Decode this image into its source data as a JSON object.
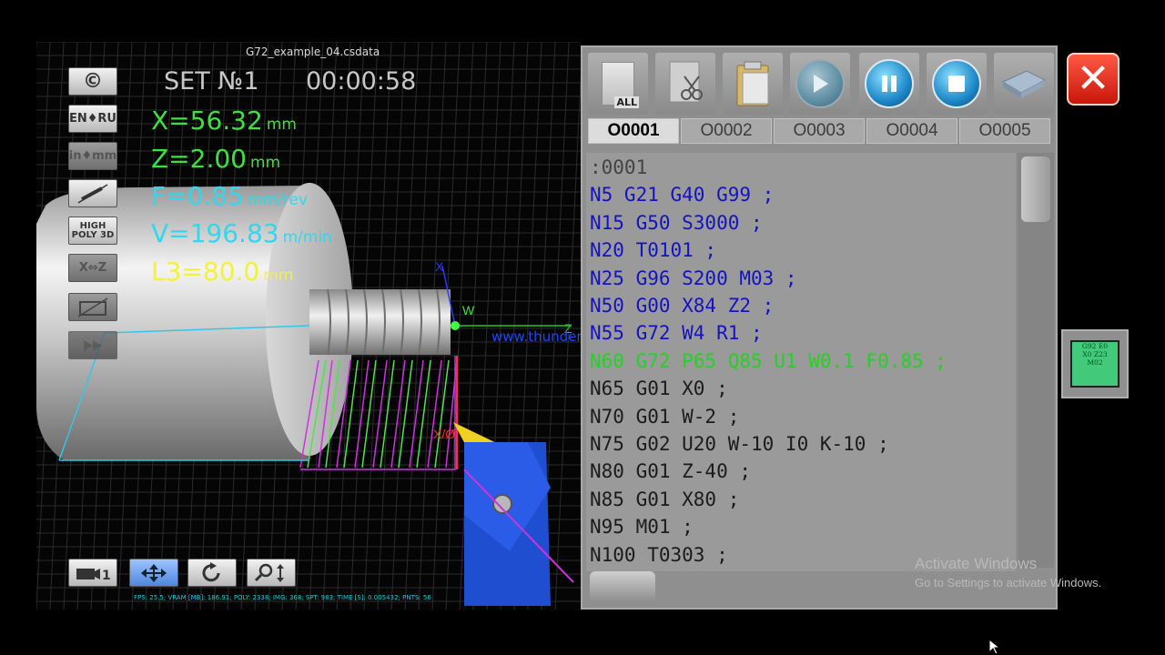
{
  "viewport": {
    "file_title": "G72_example_04.csdata",
    "set_label": "SET №1",
    "timer": "00:00:58",
    "side_buttons": [
      {
        "label": "©",
        "icon": "copyright-icon"
      },
      {
        "label": "EN♦RU",
        "icon": "language-toggle-icon"
      },
      {
        "label": "in♦mm",
        "icon": "unit-toggle-icon"
      },
      {
        "label": "",
        "icon": "pen-off-icon"
      },
      {
        "label": "HIGH POLY 3D",
        "icon": "high-poly-3d-icon"
      },
      {
        "label": "X⇔Z",
        "icon": "axis-swap-icon"
      },
      {
        "label": "",
        "icon": "chart-off-icon"
      },
      {
        "label": "",
        "icon": "fast-forward-icon"
      }
    ],
    "params": {
      "x": {
        "text": "X=56.32",
        "unit": "mm"
      },
      "z": {
        "text": "Z=2.00",
        "unit": "mm"
      },
      "f": {
        "text": "F=0.85",
        "unit": "mm/rev"
      },
      "v": {
        "text": "V=196.83",
        "unit": "m/min"
      },
      "l3": {
        "text": "L3=80.0",
        "unit": "mm"
      }
    },
    "axis_labels": {
      "x": "X",
      "z": "Z",
      "w": "W",
      "xo": "X/Ø"
    },
    "watermark_url": "www.thundershare.net",
    "bottom_buttons": [
      {
        "label": "📷1",
        "icon": "camera-1-icon"
      },
      {
        "label": "✥",
        "icon": "pan-arrows-icon"
      },
      {
        "label": "↺",
        "icon": "rotate-icon"
      },
      {
        "label": "🔍↕",
        "icon": "zoom-icon"
      }
    ],
    "stats": "FPS: 25.5; VRAM [MB]: 186.91; POLY: 2338; IMG: 368; SPT: 983; TIME [S]: 0.005432; PNTS: 56"
  },
  "editor": {
    "toolbar": [
      {
        "icon": "select-all-icon",
        "label": "ALL"
      },
      {
        "icon": "cut-icon",
        "label": ""
      },
      {
        "icon": "paste-icon",
        "label": ""
      },
      {
        "icon": "play-icon",
        "label": ""
      },
      {
        "icon": "pause-icon",
        "label": ""
      },
      {
        "icon": "stop-icon",
        "label": ""
      },
      {
        "icon": "book-icon",
        "label": ""
      }
    ],
    "tabs": [
      "O0001",
      "O0002",
      "O0003",
      "O0004",
      "O0005"
    ],
    "active_tab": 0,
    "lines": [
      {
        "text": ":0001",
        "style": "header"
      },
      {
        "text": "N5 G21 G40 G99 ;",
        "style": "normal"
      },
      {
        "text": "N15 G50 S3000 ;",
        "style": "normal"
      },
      {
        "text": "N20 T0101 ;",
        "style": "normal"
      },
      {
        "text": "N25 G96 S200 M03 ;",
        "style": "normal"
      },
      {
        "text": "N50 G00 X84 Z2 ;",
        "style": "normal"
      },
      {
        "text": "N55 G72 W4 R1 ;",
        "style": "normal"
      },
      {
        "text": "N60 G72 P65 Q85 U1 W0.1 F0.85 ;",
        "style": "current"
      },
      {
        "text": "N65 G01 X0 ;",
        "style": "past"
      },
      {
        "text": "N70 G01 W-2 ;",
        "style": "past"
      },
      {
        "text": "N75 G02 U20 W-10 I0 K-10 ;",
        "style": "past"
      },
      {
        "text": "N80 G01 Z-40 ;",
        "style": "past"
      },
      {
        "text": "N85 G01 X80 ;",
        "style": "past"
      },
      {
        "text": "N95 M01 ;",
        "style": "past"
      },
      {
        "text": "N100 T0303 ;",
        "style": "past"
      }
    ]
  },
  "close_label": "✕",
  "gcode_widget": [
    "G92 E0",
    "X0 Z23",
    "M02"
  ],
  "activation": {
    "title": "Activate Windows",
    "subtitle": "Go to Settings to activate Windows."
  }
}
